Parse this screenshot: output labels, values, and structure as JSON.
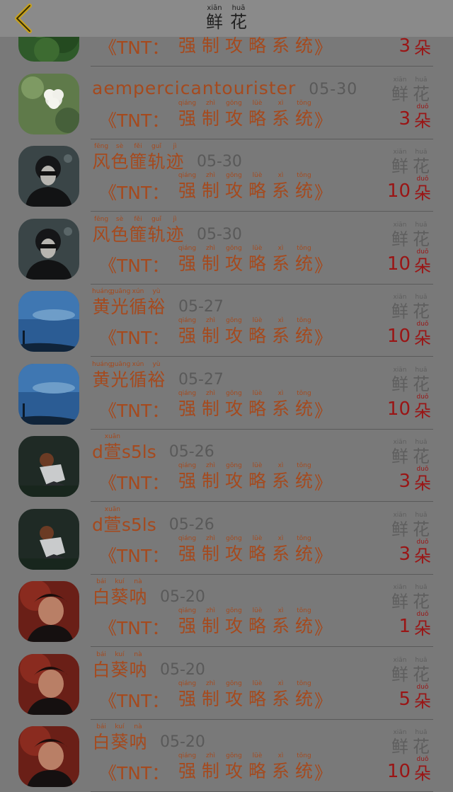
{
  "header": {
    "title_py": [
      "xiān",
      "huā"
    ],
    "title_cn": [
      "鲜",
      "花"
    ]
  },
  "colors": {
    "background": "#797979",
    "header": "#8a8a8a",
    "name": "#a54a1e",
    "quantity": "#9a1515",
    "muted": "#5e5e5e"
  },
  "book": {
    "prefix": "《TNT：",
    "py": [
      "qiáng",
      "zhì",
      "gōng",
      "lüè",
      "xì",
      "tǒng"
    ],
    "cn": [
      "强",
      "制",
      "攻",
      "略",
      "系",
      "统"
    ],
    "suffix": "》"
  },
  "gift": {
    "py": [
      "xiān",
      "huā"
    ],
    "cn": [
      "鲜",
      "花"
    ],
    "unit_py": "duǒ",
    "unit_cn": "朵"
  },
  "items": [
    {
      "name_type": "cn",
      "name_py": [],
      "name_cn": [],
      "date": "",
      "qty": "3",
      "avatar": "avatar-forest-icon"
    },
    {
      "name_type": "latin",
      "name": "aempercicantourister",
      "date": "05-30",
      "qty": "3",
      "avatar": "avatar-white-flower-icon"
    },
    {
      "name_type": "cn",
      "name_py": [
        "fēng",
        "sè",
        "fěi",
        "guǐ",
        "jì"
      ],
      "name_cn": [
        "风",
        "色",
        "篚",
        "轨",
        "迹"
      ],
      "date": "05-30",
      "qty": "10",
      "avatar": "avatar-person-masked-icon"
    },
    {
      "name_type": "cn",
      "name_py": [
        "fēng",
        "sè",
        "fěi",
        "guǐ",
        "jì"
      ],
      "name_cn": [
        "风",
        "色",
        "篚",
        "轨",
        "迹"
      ],
      "date": "05-30",
      "qty": "10",
      "avatar": "avatar-person-masked-icon"
    },
    {
      "name_type": "cn",
      "name_py": [
        "huáng",
        "guāng",
        "xún",
        "yù"
      ],
      "name_cn": [
        "黄",
        "光",
        "循",
        "裕"
      ],
      "date": "05-27",
      "qty": "10",
      "avatar": "avatar-blue-sky-icon"
    },
    {
      "name_type": "cn",
      "name_py": [
        "huáng",
        "guāng",
        "xún",
        "yù"
      ],
      "name_cn": [
        "黄",
        "光",
        "循",
        "裕"
      ],
      "date": "05-27",
      "qty": "10",
      "avatar": "avatar-blue-sky-icon"
    },
    {
      "name_type": "mixed",
      "name_a": "d",
      "name_py": [
        "xuān"
      ],
      "name_cn": [
        "萱"
      ],
      "name_b": "s5ls",
      "date": "05-26",
      "qty": "3",
      "avatar": "avatar-sitting-person-icon"
    },
    {
      "name_type": "mixed",
      "name_a": "d",
      "name_py": [
        "xuān"
      ],
      "name_cn": [
        "萱"
      ],
      "name_b": "s5ls",
      "date": "05-26",
      "qty": "3",
      "avatar": "avatar-sitting-person-icon"
    },
    {
      "name_type": "cn",
      "name_py": [
        "bái",
        "kuí",
        "nà"
      ],
      "name_cn": [
        "白",
        "葵",
        "呐"
      ],
      "date": "05-20",
      "qty": "1",
      "avatar": "avatar-red-portrait-icon"
    },
    {
      "name_type": "cn",
      "name_py": [
        "bái",
        "kuí",
        "nà"
      ],
      "name_cn": [
        "白",
        "葵",
        "呐"
      ],
      "date": "05-20",
      "qty": "5",
      "avatar": "avatar-red-portrait-icon"
    },
    {
      "name_type": "cn",
      "name_py": [
        "bái",
        "kuí",
        "nà"
      ],
      "name_cn": [
        "白",
        "葵",
        "呐"
      ],
      "date": "05-20",
      "qty": "10",
      "avatar": "avatar-red-portrait-icon"
    }
  ]
}
